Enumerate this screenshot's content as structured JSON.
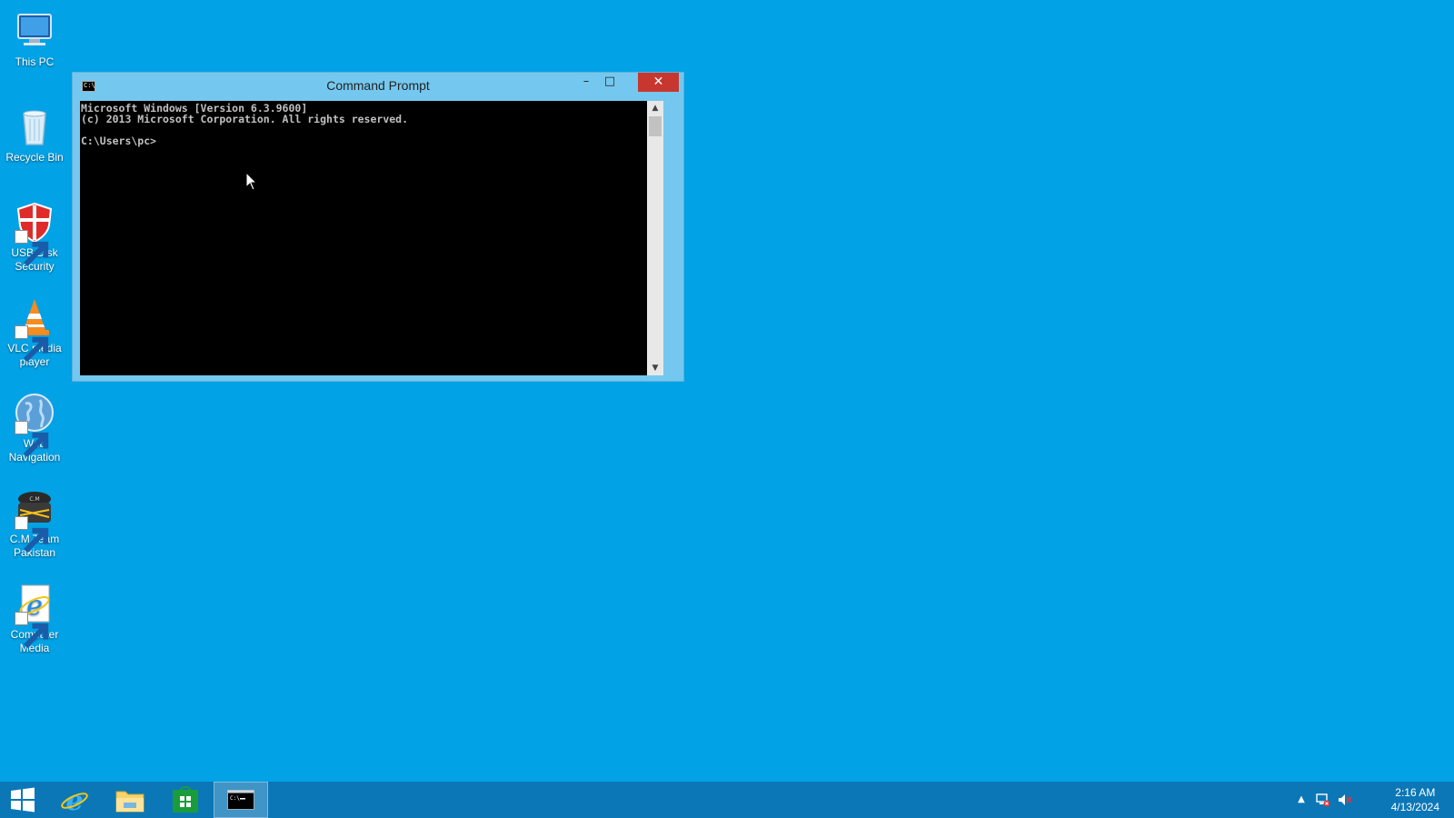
{
  "desktop": {
    "icons": [
      {
        "label": "This PC",
        "icon": "this-pc-icon"
      },
      {
        "label": "Recycle Bin",
        "icon": "recycle-bin-icon"
      },
      {
        "label": "USB Disk Security",
        "icon": "usb-disk-security-icon"
      },
      {
        "label": "VLC media player",
        "icon": "vlc-icon"
      },
      {
        "label": "Web Navigation",
        "icon": "globe-icon"
      },
      {
        "label": "C.M Team Pakistan",
        "icon": "cm-team-icon"
      },
      {
        "label": "Computer Media",
        "icon": "internet-explorer-icon"
      }
    ]
  },
  "window": {
    "title": "Command Prompt",
    "icon_text": "C:\\",
    "minimize_label": "–",
    "maximize_label": "□",
    "close_label": "✕",
    "console_lines": [
      "Microsoft Windows [Version 6.3.9600]",
      "(c) 2013 Microsoft Corporation. All rights reserved.",
      "",
      "C:\\Users\\pc>"
    ]
  },
  "taskbar": {
    "items": [
      {
        "name": "start",
        "icon": "windows-logo-icon"
      },
      {
        "name": "internet-explorer",
        "icon": "internet-explorer-icon"
      },
      {
        "name": "file-explorer",
        "icon": "folder-icon"
      },
      {
        "name": "store",
        "icon": "store-icon"
      },
      {
        "name": "command-prompt",
        "icon": "cmd-icon",
        "active": true
      }
    ],
    "tray": {
      "show_hidden_icon": "▲",
      "time": "2:16 AM",
      "date": "4/13/2024"
    }
  },
  "colors": {
    "desktop": "#01a2e6",
    "taskbar": "#0b77b7",
    "window_frame": "#74c8ef",
    "close_button": "#c7372f"
  }
}
